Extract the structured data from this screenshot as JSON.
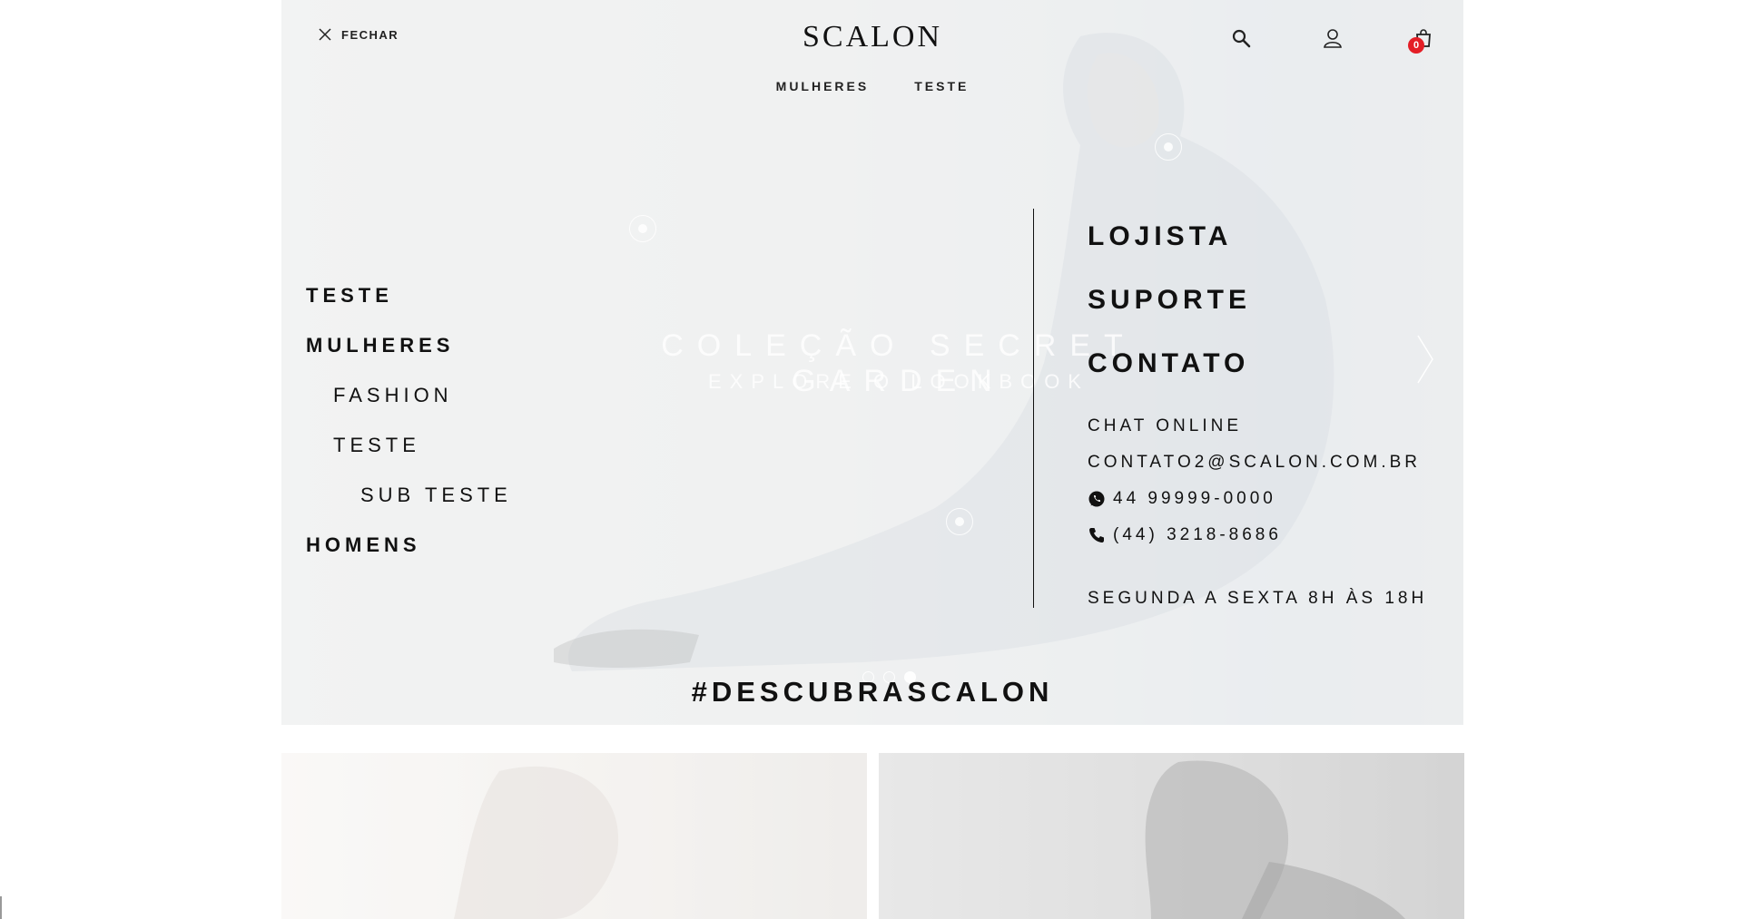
{
  "header": {
    "close_label": "FECHAR",
    "logo_text": "SCALON",
    "nav": [
      "MULHERES",
      "TESTE"
    ],
    "icons": [
      "search-icon",
      "user-icon",
      "cart-icon"
    ],
    "cart_count": "0",
    "accent_color": "#e41e26"
  },
  "hero": {
    "title": "COLEÇÃO SECRET GARDEN",
    "subtitle": "EXPLORE O LOOKBOOK",
    "slide_count": 3,
    "active_slide": 3
  },
  "menu": {
    "items": [
      {
        "label": "TESTE",
        "level": 0
      },
      {
        "label": "MULHERES",
        "level": 0
      },
      {
        "label": "FASHION",
        "level": 1
      },
      {
        "label": "TESTE",
        "level": 1
      },
      {
        "label": "SUB TESTE",
        "level": 2
      },
      {
        "label": "HOMENS",
        "level": 0
      }
    ]
  },
  "info": {
    "links": [
      "LOJISTA",
      "SUPORTE",
      "CONTATO"
    ],
    "chat": "CHAT ONLINE",
    "email": "CONTATO2@SCALON.COM.BR",
    "whatsapp": "44 99999-0000",
    "phone": "(44) 3218-8686",
    "hours": "SEGUNDA A SEXTA 8H ÀS 18H"
  },
  "discover_tag": "#DESCUBRASCALON"
}
